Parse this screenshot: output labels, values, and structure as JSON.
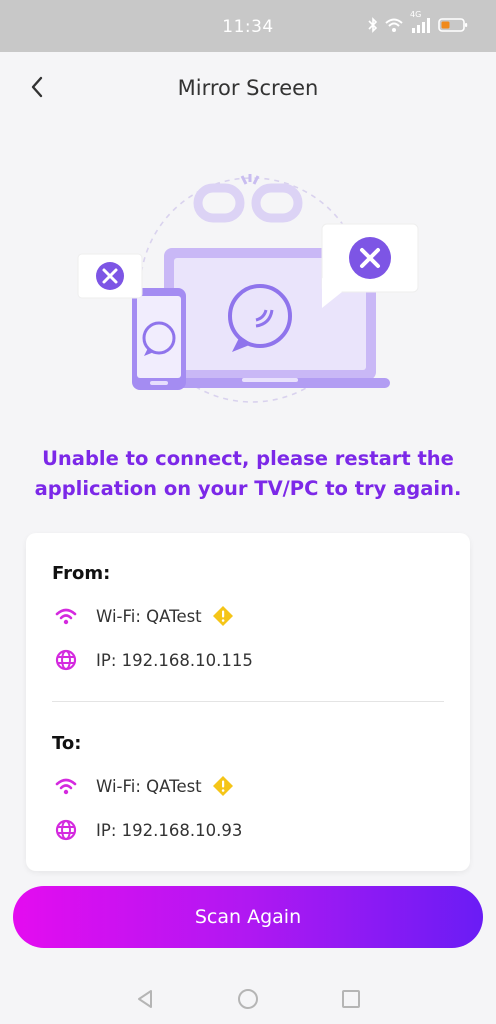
{
  "status_bar": {
    "time": "11:34",
    "network": "4G",
    "icons": [
      "bluetooth-icon",
      "wifi-icon",
      "signal-icon",
      "battery-icon"
    ],
    "battery_color": "#f08a1c"
  },
  "header": {
    "title": "Mirror Screen",
    "back_icon": "chevron-left-icon"
  },
  "message": "Unable to connect, please restart the application on your TV/PC to try again.",
  "connection": {
    "from": {
      "label": "From:",
      "wifi": "Wi-Fi: QATest",
      "ip": "IP: 192.168.10.115"
    },
    "to": {
      "label": "To:",
      "wifi": "Wi-Fi: QATest",
      "ip": "IP: 192.168.10.93"
    }
  },
  "scan_button": {
    "label": "Scan Again"
  },
  "colors": {
    "accent": "#7c28e8",
    "icon_magenta": "#d42adf",
    "warning": "#f5c518",
    "button_gradient_start": "#e40cf0",
    "button_gradient_end": "#6a1cf5"
  },
  "nav_bar": {
    "icons": [
      "back-triangle-icon",
      "home-circle-icon",
      "recents-square-icon"
    ]
  }
}
